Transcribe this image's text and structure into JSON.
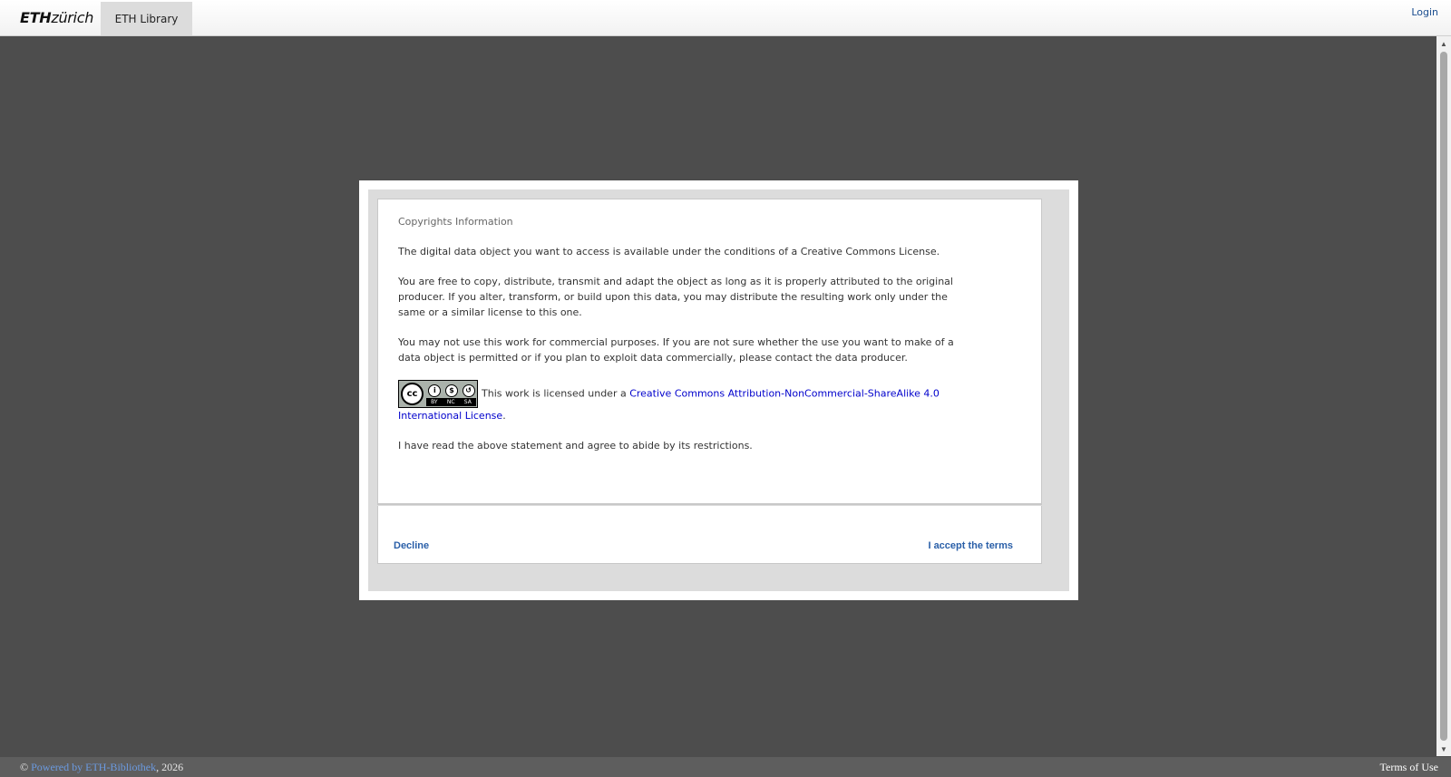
{
  "header": {
    "logo_eth": "ETH",
    "logo_zurich": "zürich",
    "library_tab": "ETH Library",
    "login": "Login"
  },
  "modal": {
    "title": "Copyrights Information",
    "paragraph1": "The digital data object you want to access is available under the conditions of a Creative Commons License.",
    "paragraph2": "You are free to copy, distribute, transmit and adapt the object as long as it is properly attributed to the original producer. If you alter, transform, or build upon this data, you may distribute the resulting work only under the same or a similar license to this one.",
    "paragraph3": "You may not use this work for commercial purposes. If you are not sure whether the use you want to make of a data object is permitted or if you plan to exploit data commercially, please contact the data producer.",
    "license_prefix": "This work is licensed under a ",
    "license_link": "Creative Commons Attribution-NonCommercial-ShareAlike 4.0 International License",
    "license_suffix": ".",
    "badge": {
      "cc": "cc",
      "by": "BY",
      "nc": "NC",
      "sa": "SA"
    },
    "agreement": "I have read the above statement and agree to abide by its restrictions.",
    "decline_label": "Decline",
    "accept_label": "I accept the terms"
  },
  "footer": {
    "copyright_symbol": "©",
    "powered_by": "Powered by ETH-Bibliothek",
    "year_text": ", 2026",
    "terms": "Terms of Use"
  },
  "colors": {
    "background": "#4d4d4d",
    "link": "#0000cc",
    "button_text": "#2a5fa8"
  }
}
